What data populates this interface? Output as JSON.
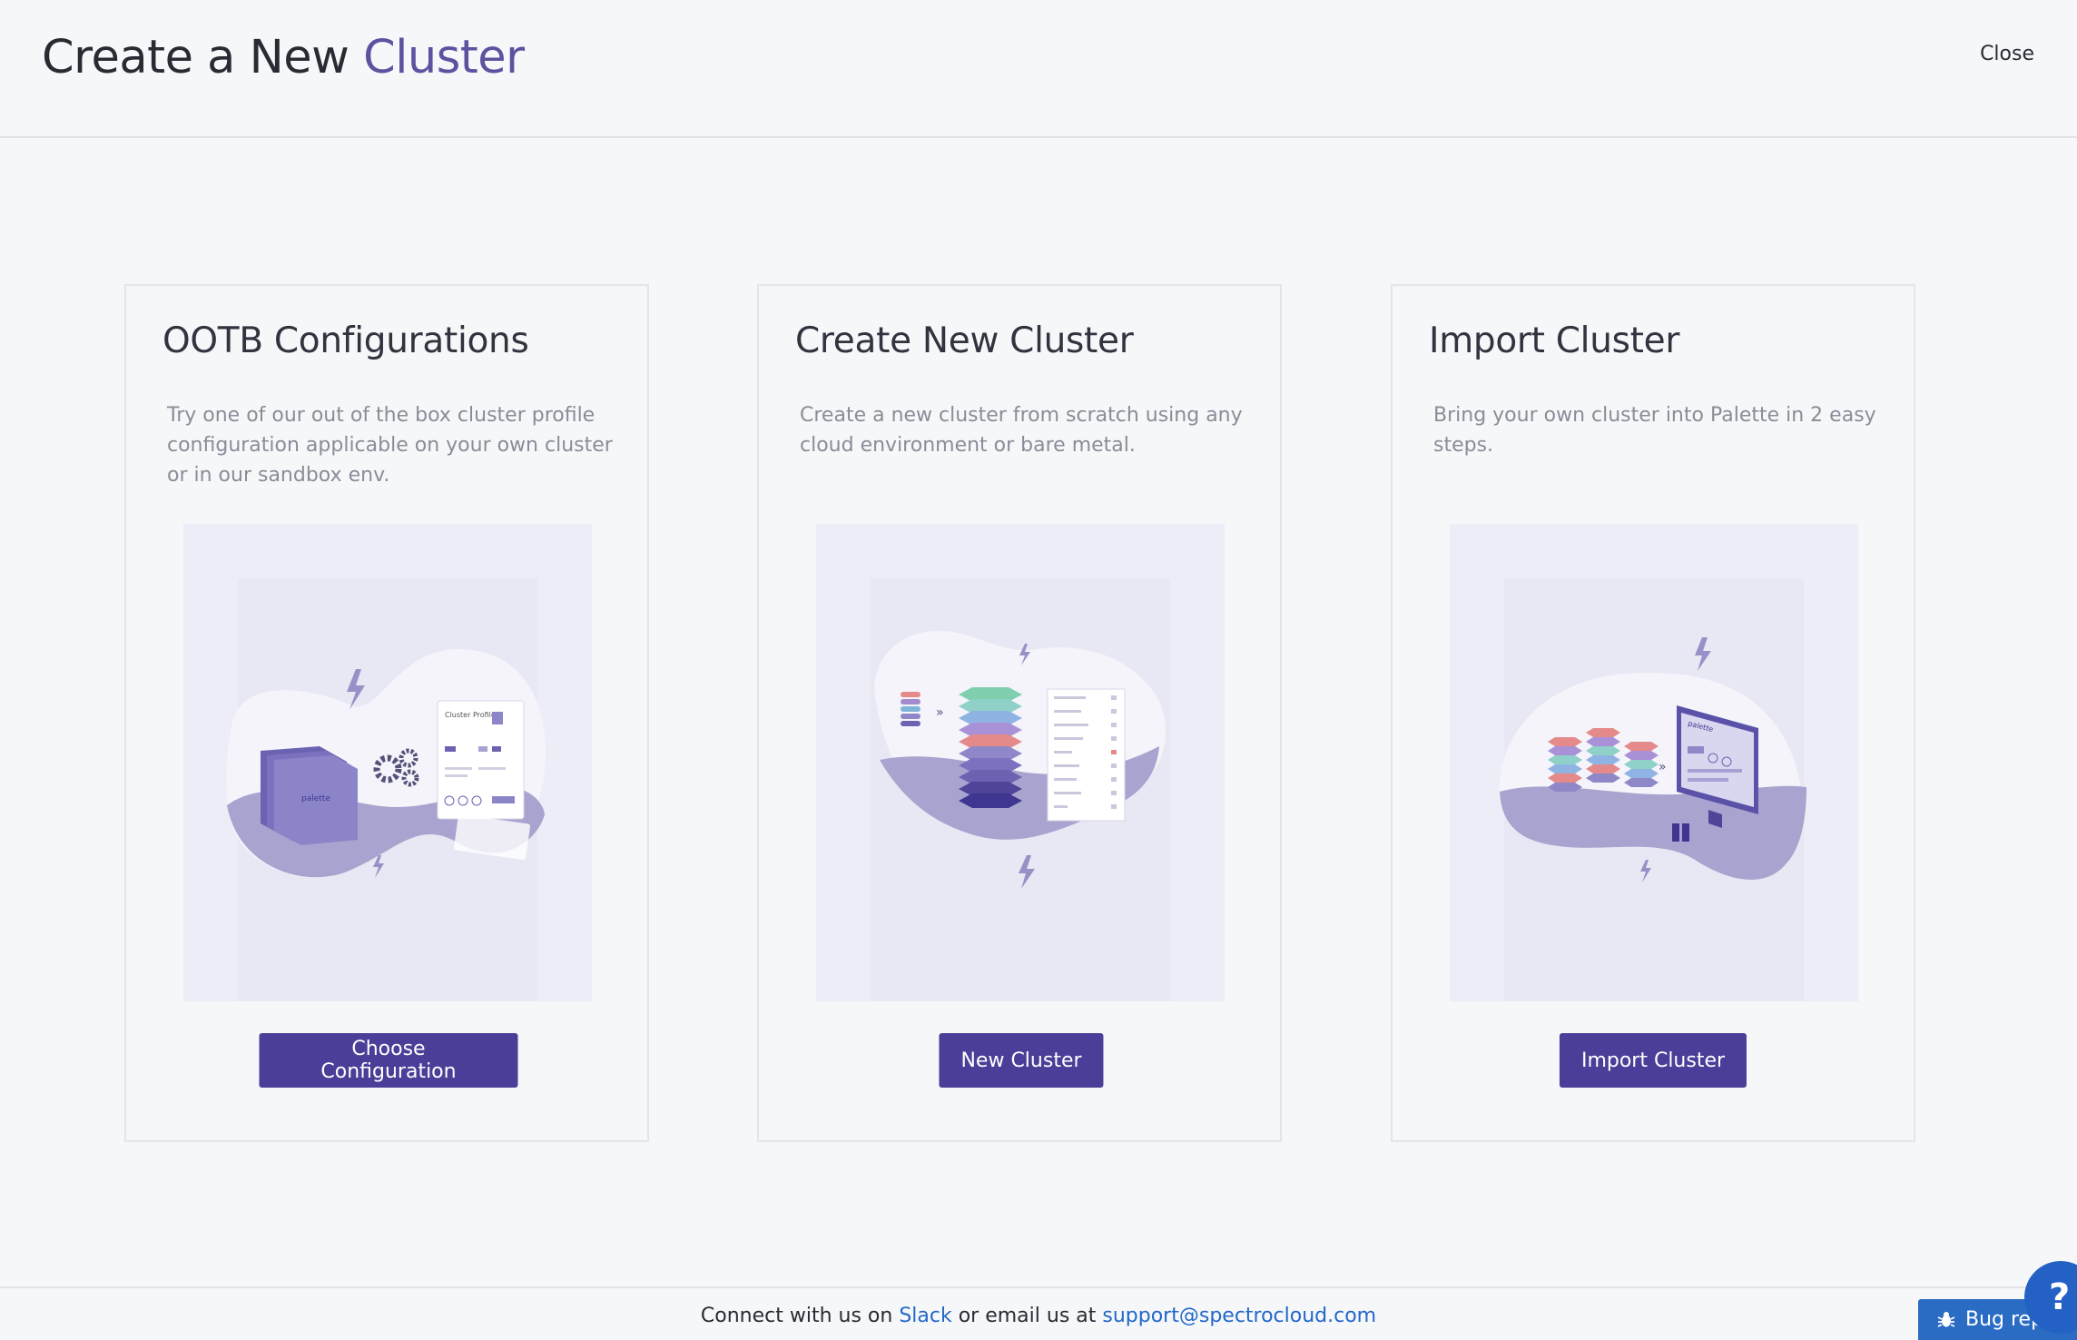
{
  "header": {
    "title_prefix": "Create a New",
    "title_accent": "Cluster",
    "close_label": "Close"
  },
  "cards": [
    {
      "title": "OOTB Configurations",
      "description": "Try one of our out of the box cluster profile configuration applicable on your own cluster or in our sandbox env.",
      "button_label": "Choose Configuration",
      "illustration": {
        "panel_title": "Cluster Profile",
        "folder_logo": "palette"
      }
    },
    {
      "title": "Create New Cluster",
      "description": "Create a new cluster from scratch using any cloud environment or bare metal.",
      "button_label": "New Cluster"
    },
    {
      "title": "Import Cluster",
      "description": "Bring your own cluster into Palette in 2 easy steps.",
      "button_label": "Import Cluster",
      "illustration": {
        "monitor_logo": "palette"
      }
    }
  ],
  "footer": {
    "text_before": "Connect with us on",
    "slack_label": "Slack",
    "text_middle": "or email us at",
    "email": "support@spectrocloud.com"
  },
  "bug_report_label": "Bug report",
  "help_label": "?",
  "colors": {
    "accent": "#5b53a0",
    "button": "#4a3f98",
    "link": "#2268c8",
    "bug_button": "#2a6bc4"
  }
}
